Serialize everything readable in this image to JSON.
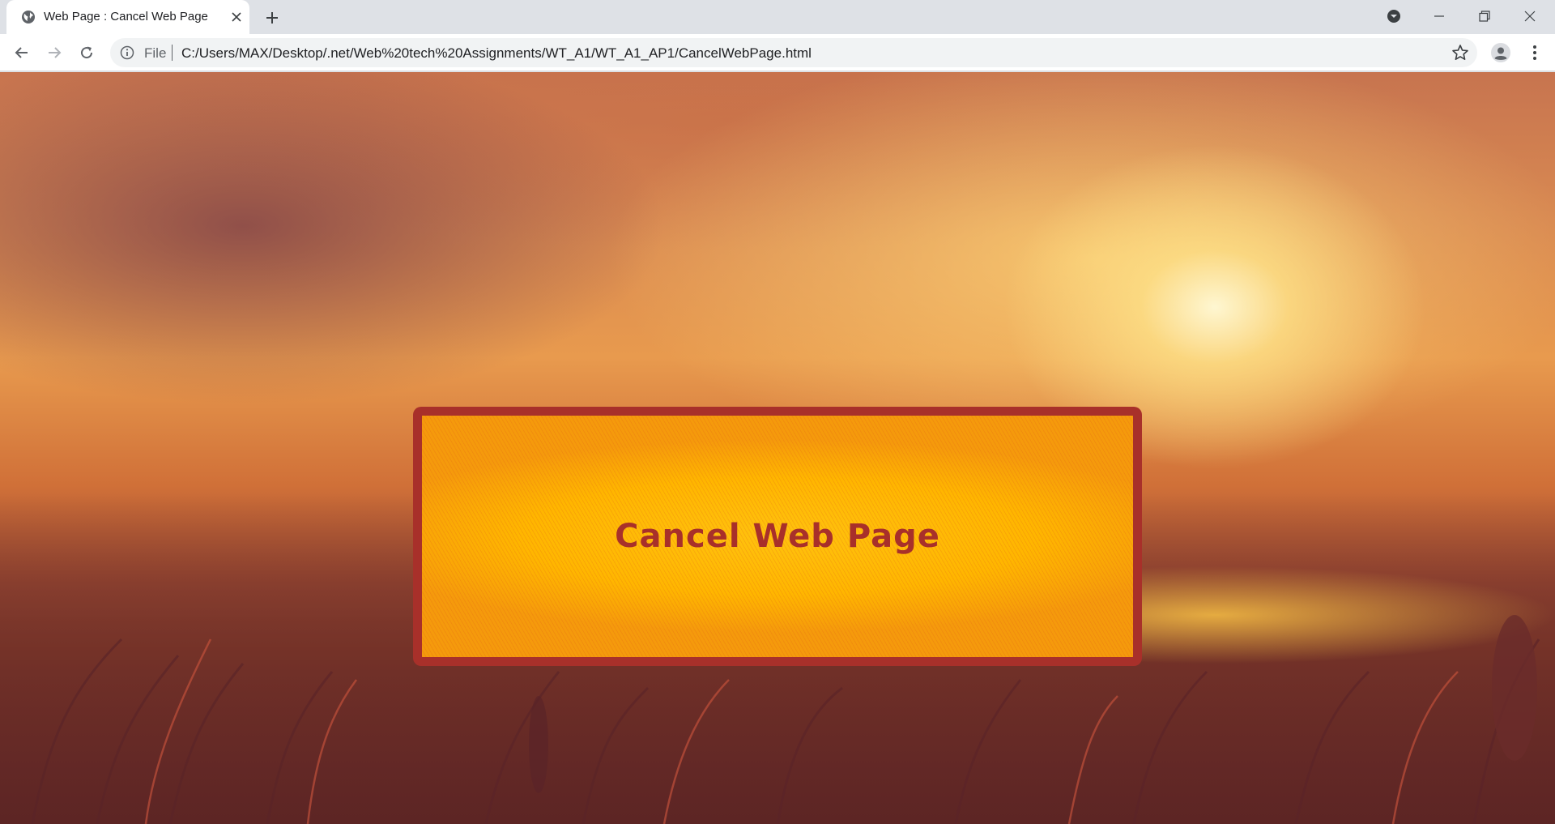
{
  "browser": {
    "tab": {
      "title": "Web Page : Cancel Web Page",
      "favicon": "globe-icon"
    },
    "address_bar": {
      "scheme_label": "File",
      "url": "C:/Users/MAX/Desktop/.net/Web%20tech%20Assignments/WT_A1/WT_A1_AP1/CancelWebPage.html"
    }
  },
  "page": {
    "heading": "Cancel Web Page",
    "colors": {
      "box_border": "#a8302a",
      "box_fill": "#ffbb0a",
      "heading_text": "#a8302a"
    }
  }
}
